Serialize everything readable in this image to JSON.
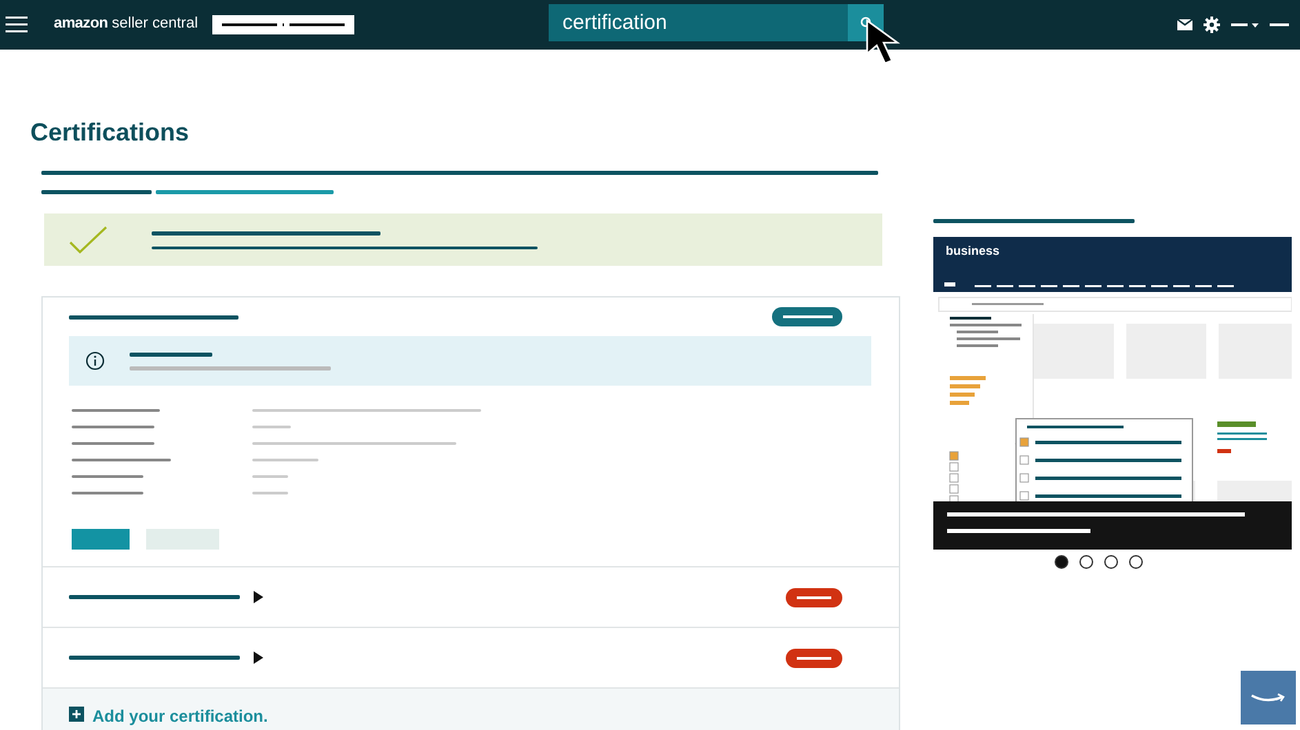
{
  "header": {
    "logo": {
      "brand": "amazon",
      "product": "seller central"
    },
    "search": {
      "value": "certification"
    }
  },
  "page": {
    "title": "Certifications"
  },
  "certification_card": {
    "rows": [
      {
        "expanded": false
      },
      {
        "expanded": false
      }
    ],
    "add_link": "Add your certification."
  },
  "promo": {
    "illustration_logo": "business",
    "carousel": [
      {
        "selected": true
      },
      {
        "selected": false
      },
      {
        "selected": false
      },
      {
        "selected": false
      }
    ]
  }
}
